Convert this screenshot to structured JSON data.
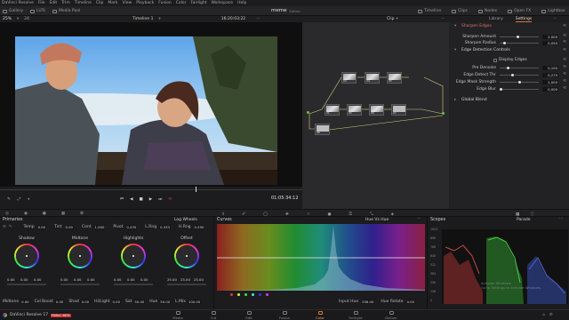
{
  "menu": {
    "items": [
      "DaVinci Resolve",
      "File",
      "Edit",
      "Trim",
      "Timeline",
      "Clip",
      "Mark",
      "View",
      "Playback",
      "Fusion",
      "Color",
      "Fairlight",
      "Workspace",
      "Help"
    ]
  },
  "toolbar": {
    "left": [
      {
        "label": "Gallery",
        "icon": "gallery-icon"
      },
      {
        "label": "LUTs",
        "icon": "luts-icon"
      },
      {
        "label": "Media Pool",
        "icon": "media-pool-icon"
      }
    ],
    "project_title": "meme",
    "project_status": "Edited",
    "right": [
      {
        "label": "Timeline",
        "icon": "timeline-icon"
      },
      {
        "label": "Clips",
        "icon": "clips-icon"
      },
      {
        "label": "Nodes",
        "icon": "nodes-icon"
      },
      {
        "label": "Open FX",
        "icon": "openfx-icon"
      },
      {
        "label": "Lightbox",
        "icon": "lightbox-icon"
      }
    ]
  },
  "viewer": {
    "zoom": "25%",
    "zoom2": "24",
    "timeline_name": "Timeline 1",
    "timecode_top": "16:20:03:22",
    "timecode": "01:05:34:12"
  },
  "nodes": {
    "mode": "Clip",
    "labels": [
      "03",
      "04",
      "05",
      "01",
      "02",
      "06",
      "07",
      "08"
    ]
  },
  "inspector": {
    "tabs": [
      "Library",
      "Settings"
    ],
    "sections": {
      "sharpen": "Sharpen Edges",
      "edge_detection": "Edge Detection Controls",
      "display_edges": "Display Edges",
      "global_blend": "Global Blend"
    },
    "params": [
      {
        "label": "Sharpen Amount",
        "value": "2,000",
        "pos": 0.45
      },
      {
        "label": "Sharpen Radius",
        "value": "0,050",
        "pos": 0.1
      },
      {
        "label": "Pre Denoise",
        "value": "0,100",
        "pos": 0.2
      },
      {
        "label": "Edge Detect Thr",
        "value": "0,275",
        "pos": 0.3
      },
      {
        "label": "Edge Mask Strength",
        "value": "2,000",
        "pos": 0.5
      },
      {
        "label": "Edge Blur",
        "value": "0,000",
        "pos": 0.0
      }
    ]
  },
  "primaries": {
    "title": "Primaries",
    "mode": "Log Wheels",
    "temp_label": "Temp",
    "temp": "0.00",
    "tint_label": "Tint",
    "tint": "0.00",
    "cont_label": "Cont",
    "cont": "1.000",
    "pivot_label": "Pivot",
    "pivot": "0.435",
    "lrng_label": "L.Rng",
    "lrng": "0.333",
    "hrng_label": "H.Rng",
    "hrng": "0.550",
    "wheels": [
      {
        "name": "Shadow",
        "r": "0.00",
        "g": "0.00",
        "b": "0.00"
      },
      {
        "name": "Midtone",
        "r": "0.00",
        "g": "0.00",
        "b": "0.00"
      },
      {
        "name": "Highlights",
        "r": "0.00",
        "g": "0.00",
        "b": "0.00"
      },
      {
        "name": "Offset",
        "r": "25.00",
        "g": "25.00",
        "b": "25.00"
      }
    ],
    "bottom": [
      {
        "label": "Midtone",
        "value": "0.00"
      },
      {
        "label": "Col Boost",
        "value": "0.00"
      },
      {
        "label": "Shad",
        "value": "0.00"
      },
      {
        "label": "Hi/Light",
        "value": "0.00"
      },
      {
        "label": "Sat",
        "value": "50.00"
      },
      {
        "label": "Hue",
        "value": "50.00"
      },
      {
        "label": "L.Mix",
        "value": "100.00"
      }
    ]
  },
  "curves": {
    "title": "Curves",
    "mode": "Hue Vs Hue",
    "input_hue_label": "Input Hue",
    "input_hue": "256.00",
    "hue_rotate_label": "Hue Rotate",
    "hue_rotate": "0.00"
  },
  "scopes": {
    "title": "Scopes",
    "mode": "Parade",
    "ticks": [
      "1023",
      "896",
      "768",
      "640",
      "512",
      "384",
      "256",
      "128",
      "0"
    ],
    "watermark": "Activate Windows\nGo to Settings to activate Windows."
  },
  "pages": {
    "app": "DaVinci Resolve 17",
    "badge": "PUBLIC BETA",
    "tabs": [
      {
        "label": "Media",
        "active": false
      },
      {
        "label": "Cut",
        "active": false
      },
      {
        "label": "Edit",
        "active": false
      },
      {
        "label": "Fusion",
        "active": false
      },
      {
        "label": "Color",
        "active": true
      },
      {
        "label": "Fairlight",
        "active": false
      },
      {
        "label": "Deliver",
        "active": false
      }
    ]
  },
  "colors": {
    "accent": "#e8732a",
    "active_tab": "#e8a060",
    "panel": "#1c1c1e",
    "node_bg": "#2a2a2d"
  }
}
